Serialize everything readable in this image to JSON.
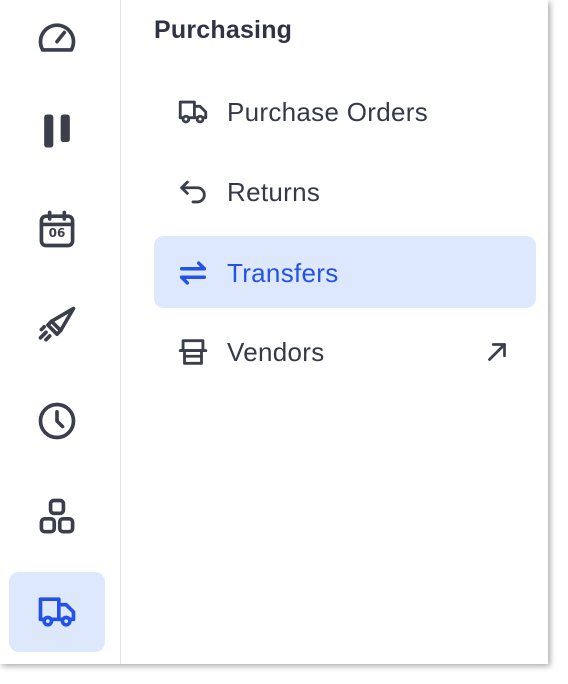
{
  "colors": {
    "accent": "#2352e6",
    "active_background": "#dde8fc",
    "icon": "#3a3f4b",
    "text": "#343a47",
    "divider": "#dfe3ea"
  },
  "rail": {
    "items": [
      {
        "icon": "gauge-icon",
        "active": false
      },
      {
        "icon": "pause-icon",
        "active": false
      },
      {
        "icon": "calendar-icon",
        "label": "06",
        "active": false
      },
      {
        "icon": "rocket-icon",
        "active": false
      },
      {
        "icon": "clock-icon",
        "active": false
      },
      {
        "icon": "blocks-icon",
        "active": false
      },
      {
        "icon": "truck-icon",
        "active": true
      }
    ]
  },
  "panel": {
    "title": "Purchasing",
    "items": [
      {
        "label": "Purchase Orders",
        "icon": "truck-icon",
        "active": false
      },
      {
        "label": "Returns",
        "icon": "return-arrow-icon",
        "active": false
      },
      {
        "label": "Transfers",
        "icon": "transfer-arrows-icon",
        "active": true
      },
      {
        "label": "Vendors",
        "icon": "store-icon",
        "active": false,
        "external": true,
        "external_icon": "arrow-up-right-icon"
      }
    ]
  }
}
